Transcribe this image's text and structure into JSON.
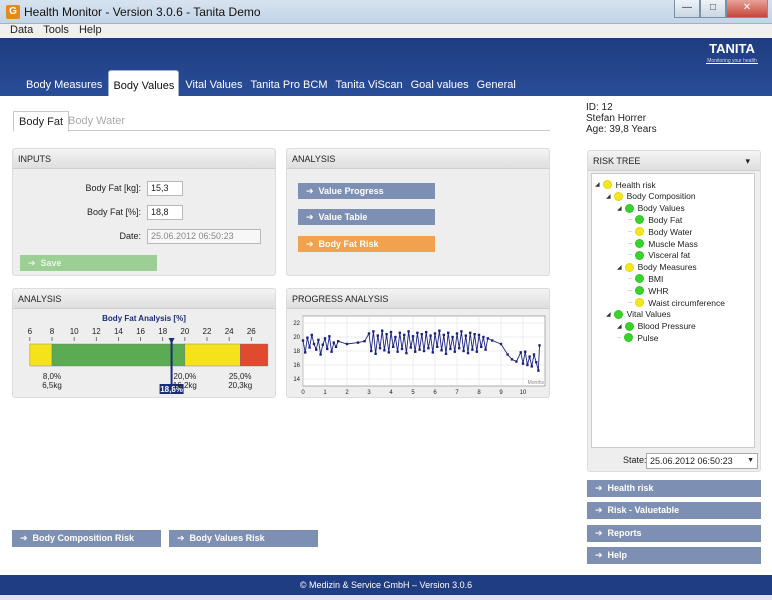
{
  "window": {
    "title": "Health Monitor - Version 3.0.6 - Tanita Demo",
    "icon_letter": "G",
    "minimize": "—",
    "maximize": "□",
    "close": "✕"
  },
  "menu": [
    "Data",
    "Tools",
    "Help"
  ],
  "brand": {
    "logo": "TANITA",
    "tagline": "Monitoring your health"
  },
  "tabs": [
    "Body Measures",
    "Body Values",
    "Vital Values",
    "Tanita Pro BCM",
    "Tanita ViScan",
    "Goal values",
    "General"
  ],
  "active_tab": "Body Values",
  "subtabs": {
    "active": "Body Fat",
    "inactive": "Body Water"
  },
  "patient": {
    "id": "ID: 12",
    "name": "Stefan Horrer",
    "age": "Age: 39,8 Years"
  },
  "inputs": {
    "title": "INPUTS",
    "kg_label": "Body Fat [kg]:",
    "kg_value": "15,3",
    "pct_label": "Body Fat [%]:",
    "pct_value": "18,8",
    "date_label": "Date:",
    "date_value": "25.06.2012 06:50:23",
    "save": "Save"
  },
  "analysis_top": {
    "title": "ANALYSIS",
    "buttons": [
      "Value Progress",
      "Value Table",
      "Body Fat Risk"
    ]
  },
  "analysis_bottom": {
    "title": "ANALYSIS",
    "chart_title": "Body Fat Analysis [%]",
    "ticks": [
      "6",
      "8",
      "10",
      "12",
      "14",
      "16",
      "18",
      "20",
      "22",
      "24",
      "26"
    ],
    "bands": [
      {
        "color": "#f4e31b",
        "from": 6,
        "to": 8
      },
      {
        "color": "#5bab52",
        "from": 8,
        "to": 20
      },
      {
        "color": "#f4e31b",
        "from": 20,
        "to": 25
      },
      {
        "color": "#e04a2f",
        "from": 25,
        "to": 27.5
      }
    ],
    "value": 18.8,
    "marker_label": "18,8%",
    "thresholds": [
      {
        "pct": "8,0%",
        "kg": "6,5kg"
      },
      {
        "pct": "20,0%",
        "kg": "16,2kg"
      },
      {
        "pct": "25,0%",
        "kg": "20,3kg"
      }
    ]
  },
  "progress": {
    "title": "PROGRESS ANALYSIS",
    "unit_label": "Months",
    "chart_data": {
      "type": "line",
      "xlabel": "",
      "ylabel": "",
      "xlim": [
        0,
        11
      ],
      "ylim": [
        13,
        23
      ],
      "x_ticks": [
        0,
        1,
        2,
        3,
        4,
        5,
        6,
        7,
        8,
        9,
        10
      ],
      "y_ticks": [
        14,
        16,
        18,
        20,
        22
      ],
      "series": [
        {
          "color": "#1a237e",
          "points": [
            [
              0.0,
              19.5
            ],
            [
              0.1,
              17.8
            ],
            [
              0.2,
              19.9
            ],
            [
              0.3,
              18.5
            ],
            [
              0.4,
              20.3
            ],
            [
              0.5,
              19.0
            ],
            [
              0.6,
              18.2
            ],
            [
              0.7,
              19.6
            ],
            [
              0.8,
              17.5
            ],
            [
              0.9,
              18.9
            ],
            [
              1.0,
              19.8
            ],
            [
              1.1,
              18.3
            ],
            [
              1.2,
              20.1
            ],
            [
              1.3,
              17.9
            ],
            [
              1.4,
              19.2
            ],
            [
              1.5,
              18.6
            ],
            [
              1.6,
              19.4
            ],
            [
              2.0,
              19.0
            ],
            [
              2.5,
              19.2
            ],
            [
              2.8,
              19.4
            ],
            [
              3.0,
              20.5
            ],
            [
              3.1,
              18.0
            ],
            [
              3.2,
              20.8
            ],
            [
              3.3,
              17.6
            ],
            [
              3.4,
              20.2
            ],
            [
              3.5,
              18.4
            ],
            [
              3.6,
              20.9
            ],
            [
              3.7,
              18.1
            ],
            [
              3.8,
              20.4
            ],
            [
              3.9,
              17.8
            ],
            [
              4.0,
              20.7
            ],
            [
              4.1,
              18.6
            ],
            [
              4.2,
              20.0
            ],
            [
              4.3,
              17.9
            ],
            [
              4.4,
              20.6
            ],
            [
              4.5,
              18.3
            ],
            [
              4.6,
              20.3
            ],
            [
              4.7,
              17.7
            ],
            [
              4.8,
              20.8
            ],
            [
              4.9,
              18.5
            ],
            [
              5.0,
              20.1
            ],
            [
              5.1,
              17.9
            ],
            [
              5.2,
              20.6
            ],
            [
              5.3,
              18.2
            ],
            [
              5.4,
              20.4
            ],
            [
              5.5,
              18.0
            ],
            [
              5.6,
              20.7
            ],
            [
              5.7,
              18.4
            ],
            [
              5.8,
              20.2
            ],
            [
              5.9,
              17.8
            ],
            [
              6.0,
              20.5
            ],
            [
              6.1,
              18.6
            ],
            [
              6.2,
              20.9
            ],
            [
              6.3,
              18.1
            ],
            [
              6.4,
              20.3
            ],
            [
              6.5,
              17.6
            ],
            [
              6.6,
              20.6
            ],
            [
              6.7,
              18.3
            ],
            [
              6.8,
              20.0
            ],
            [
              6.9,
              17.9
            ],
            [
              7.0,
              20.5
            ],
            [
              7.1,
              18.4
            ],
            [
              7.2,
              20.8
            ],
            [
              7.3,
              18.0
            ],
            [
              7.4,
              20.2
            ],
            [
              7.5,
              17.7
            ],
            [
              7.6,
              20.6
            ],
            [
              7.7,
              18.2
            ],
            [
              7.8,
              20.4
            ],
            [
              7.9,
              17.9
            ],
            [
              8.0,
              20.3
            ],
            [
              8.1,
              18.6
            ],
            [
              8.2,
              20.0
            ],
            [
              8.3,
              18.2
            ],
            [
              8.4,
              19.8
            ],
            [
              8.6,
              19.5
            ],
            [
              9.0,
              19.0
            ],
            [
              9.3,
              17.5
            ],
            [
              9.5,
              16.8
            ],
            [
              9.7,
              16.5
            ],
            [
              9.9,
              17.8
            ],
            [
              10.0,
              16.2
            ],
            [
              10.1,
              17.9
            ],
            [
              10.2,
              16.0
            ],
            [
              10.3,
              17.2
            ],
            [
              10.4,
              15.8
            ],
            [
              10.5,
              17.5
            ],
            [
              10.6,
              16.4
            ],
            [
              10.7,
              15.2
            ],
            [
              10.75,
              18.8
            ]
          ]
        }
      ]
    }
  },
  "risk_tree": {
    "title": "RISK TREE",
    "collapse": "▾",
    "nodes": [
      {
        "label": "Health risk",
        "level": 0,
        "color": "#f5e915",
        "expander": true
      },
      {
        "label": "Body Composition",
        "level": 1,
        "color": "#f5e915",
        "expander": true
      },
      {
        "label": "Body Values",
        "level": 2,
        "color": "#39d32b",
        "expander": true
      },
      {
        "label": "Body Fat",
        "level": 3,
        "color": "#39d32b",
        "expander": false
      },
      {
        "label": "Body Water",
        "level": 3,
        "color": "#f5e915",
        "expander": false
      },
      {
        "label": "Muscle Mass",
        "level": 3,
        "color": "#39d32b",
        "expander": false
      },
      {
        "label": "Visceral fat",
        "level": 3,
        "color": "#39d32b",
        "expander": false
      },
      {
        "label": "Body Measures",
        "level": 2,
        "color": "#f5e915",
        "expander": true
      },
      {
        "label": "BMI",
        "level": 3,
        "color": "#39d32b",
        "expander": false
      },
      {
        "label": "WHR",
        "level": 3,
        "color": "#39d32b",
        "expander": false
      },
      {
        "label": "Waist circumference",
        "level": 3,
        "color": "#f5e915",
        "expander": false
      },
      {
        "label": "Vital Values",
        "level": 1,
        "color": "#39d32b",
        "expander": true
      },
      {
        "label": "Blood Pressure",
        "level": 2,
        "color": "#39d32b",
        "expander": true
      },
      {
        "label": "Pulse",
        "level": 2,
        "color": "#39d32b",
        "expander": false
      }
    ],
    "state_label": "State:",
    "state_value": "25.06.2012 06:50:23"
  },
  "side_buttons": [
    "Health risk",
    "Risk - Valuetable",
    "Reports",
    "Help"
  ],
  "bottom_buttons": [
    "Body Composition Risk",
    "Body Values Risk"
  ],
  "footer": "© Medizin & Service GmbH – Version 3.0.6"
}
